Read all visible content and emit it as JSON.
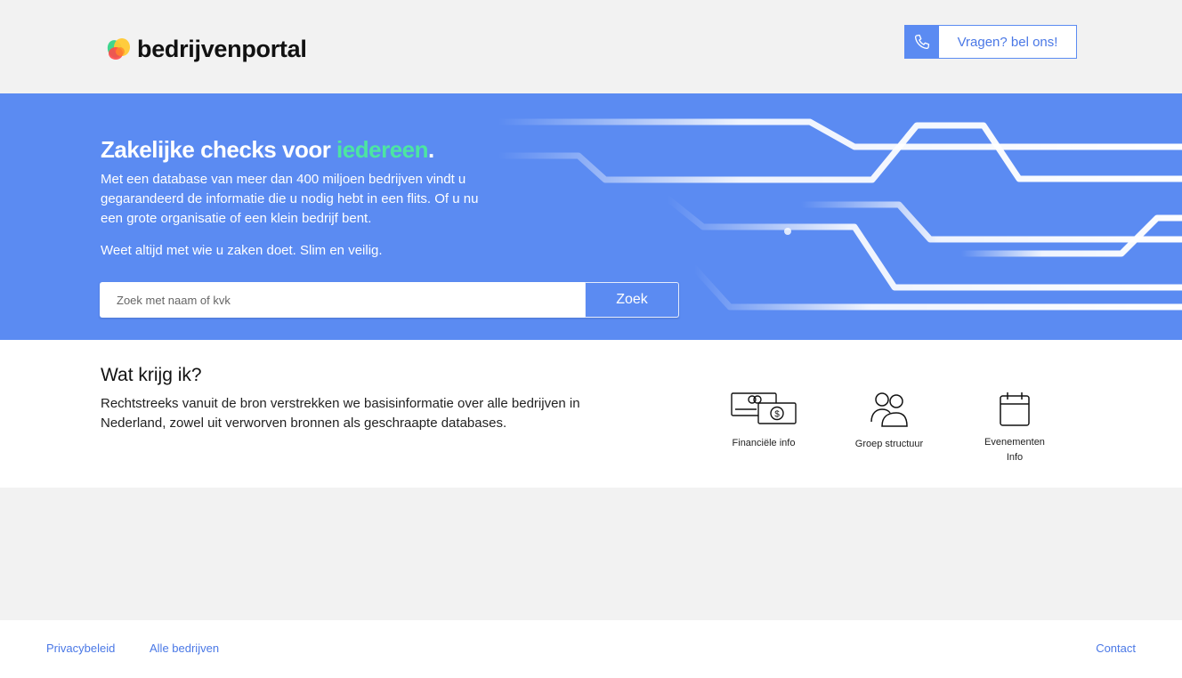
{
  "header": {
    "logo_text": "bedrijvenportal",
    "call_label": "Vragen? bel ons!",
    "call_icon": "phone-icon"
  },
  "hero": {
    "title_main": "Zakelijke checks voor ",
    "title_accent": "iedereen",
    "title_end": ".",
    "description": "Met een database van meer dan 400 miljoen bedrijven vindt u gegarandeerd de informatie die u nodig hebt in een flits. Of u nu een grote organisatie of een klein bedrijf bent.",
    "tagline": "Weet altijd met wie u zaken doet. Slim en veilig.",
    "search_placeholder": "Zoek met naam of kvk",
    "search_value": "",
    "search_button": "Zoek"
  },
  "features": {
    "title": "Wat krijg ik?",
    "description": "Rechtstreeks vanuit de bron verstrekken we basisinformatie over alle bedrijven in Nederland, zowel uit verworven bronnen als geschraapte databases.",
    "items": [
      {
        "label": "Financiële info",
        "icon": "money-icon"
      },
      {
        "label": "Groep structuur",
        "icon": "group-icon"
      },
      {
        "label_line1": "Evenementen",
        "label_line2": "Info",
        "icon": "calendar-icon"
      }
    ]
  },
  "footer": {
    "links": [
      "Privacybeleid",
      "Alle bedrijven"
    ],
    "contact": "Contact"
  },
  "colors": {
    "brand_blue": "#5b8bf2",
    "accent_green": "#4ce5a2",
    "link_blue": "#4a78e6"
  }
}
